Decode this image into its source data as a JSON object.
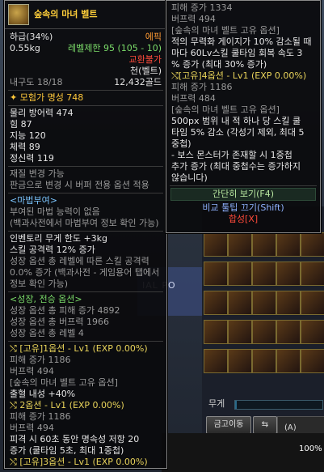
{
  "item": {
    "name": "숲속의 마녀 벨트",
    "grade_label": "하급(34%)",
    "rarity": "에픽",
    "weight": "0.55kg",
    "level_req": "레벨제한 95 (105 - 10)",
    "trade_status": "교환불가",
    "part": "천(벨트)",
    "durability": "내구도 18/18",
    "price": "12,432골드",
    "adventurer_fame": "모험가 명성 748"
  },
  "stats": [
    "물리 방어력 474",
    "힘 87",
    "지능 120",
    "체력 89",
    "정신력 119"
  ],
  "change_notes": [
    "재질 변경 가능",
    "판금으로 변경 시 버퍼 전용 옵션 적용"
  ],
  "magic_seal": {
    "header": "<마법부여>",
    "line1": "부여된 마법 능력이 없음",
    "line2": "(백과사전에서 마법부여 정보 확인 가능)"
  },
  "inventory_bonus": {
    "line1": "인벤토리 무게 한도 +3kg",
    "line2": "스킬 공격력 12% 증가"
  },
  "growth_note": {
    "line1": "성장 옵션 총 레벨에 따른 스킬 공격력",
    "line2": "0.0% 증가 (백과사전 - 게임용어 탭에서",
    "line3": "정보 확인 가능)"
  },
  "growth": {
    "header": "<성장, 전승 옵션>",
    "lines": [
      "성장 옵션 총 피해 증가 4892",
      "성장 옵션 총 버프력 1966",
      "성장 옵션 총 레벨 4"
    ]
  },
  "options_left": [
    {
      "title": "[고유]1옵션 - Lv1 (EXP 0.00%)",
      "lines": [
        "피해 증가 1186",
        "버프력 494",
        "[숲속의 마녀 벨트 고유 옵션]",
        "출혈 내성 +40%"
      ]
    },
    {
      "title": "2옵션 - Lv1 (EXP 0.00%)",
      "lines": [
        "피해 증가 1186",
        "버프력 494",
        "피격 시 60초 동안 명속성 저항 20",
        "증가 (쿨타임 5초, 최대 1중첩)"
      ]
    },
    {
      "title": "[고유]3옵션 - Lv1 (EXP 0.00%)",
      "lines": []
    }
  ],
  "right_panel": {
    "top_lines": [
      "피해 증가 1334",
      "버프력 494"
    ],
    "unique_header_1": "[숲속의 마녀 벨트 고유 옵션]",
    "effect_1_lines": [
      "적의 무력화 게이지가 10% 감소될 때",
      "마다 60Lv스킬 쿨타임 회복 속도 3",
      "% 증가 (최대 30% 증가)"
    ],
    "option4_title": "[고유]4옵션 - Lv1 (EXP 0.00%)",
    "option4_lines": [
      "피해 증가 1186",
      "버프력 484"
    ],
    "unique_header_2": "[숲속의 마녀 벨트 고유 옵션]",
    "effect_2_lines": [
      "500px 범위 내 적 하나 당 스킬 쿨",
      "타임 5% 감소 (각성기 제외, 최대 5",
      "중첩)",
      "- 보스 몬스터가 존재할 시 1중첩",
      "추가 증가 (최대 중첩수는 증가하지",
      "않습니다)"
    ],
    "action_simple": "간단히 보기(F4)",
    "action_compare": "비교 툴팁 끄기(Shift)",
    "action_synth": "합성[X]"
  },
  "inventory": {
    "weight_label": "무게",
    "weight_ratio": 0.02,
    "btn_gold": "금고이동",
    "btn_sort_glyph": "⇆",
    "btn_a": "(A)",
    "percent": "100%",
    "bg_text": "IAL PO"
  },
  "colors": {
    "name": "#ffc83a",
    "epic": "#ff9a33",
    "red": "#ff4a3a",
    "green": "#7bdc6a"
  }
}
